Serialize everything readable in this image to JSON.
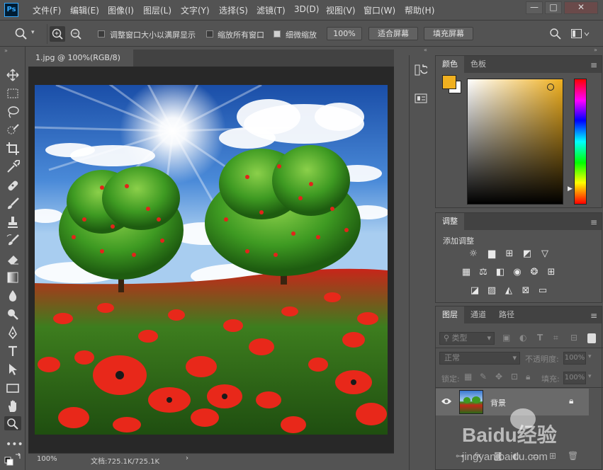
{
  "app": {
    "logo": "Ps"
  },
  "menu": [
    "文件(F)",
    "编辑(E)",
    "图像(I)",
    "图层(L)",
    "文字(Y)",
    "选择(S)",
    "滤镜(T)",
    "3D(D)",
    "视图(V)",
    "窗口(W)",
    "帮助(H)"
  ],
  "window_controls": {
    "minimize": "—",
    "maximize": "□",
    "close": "✕"
  },
  "options": {
    "resize_windows": "调整窗口大小以满屏显示",
    "zoom_all": "缩放所有窗口",
    "scrubby_zoom": "细微缩放",
    "zoom_value": "100%",
    "fit_screen": "适合屏幕",
    "fill_screen": "填充屏幕"
  },
  "document": {
    "tab_title": "1.jpg @ 100%(RGB/8)",
    "close": "×",
    "zoom": "100%",
    "doc_info": "文档:725.1K/725.1K",
    "arrow": "›"
  },
  "panels": {
    "color": {
      "tabs": [
        "颜色",
        "色板"
      ],
      "fg_color": "#f0b020",
      "bg_color": "#ffffff"
    },
    "adjustments": {
      "tab": "调整",
      "add_label": "添加调整"
    },
    "layers": {
      "tabs": [
        "图层",
        "通道",
        "路径"
      ],
      "filter_kind": "类型",
      "blend_mode": "正常",
      "opacity_label": "不透明度:",
      "opacity_value": "100%",
      "lock_label": "锁定:",
      "fill_label": "填充:",
      "fill_value": "100%",
      "layer_name": "背景"
    }
  },
  "watermark": {
    "brand": "Baidu经验",
    "url": "jingyan.baidu.com"
  },
  "icons": {
    "tools": [
      "move-icon",
      "marquee-icon",
      "lasso-icon",
      "quick-select-icon",
      "crop-icon",
      "eyedropper-icon",
      "healing-icon",
      "brush-icon",
      "stamp-icon",
      "history-brush-icon",
      "eraser-icon",
      "gradient-icon",
      "blur-icon",
      "dodge-icon",
      "pen-icon",
      "type-icon",
      "path-select-icon",
      "rectangle-icon",
      "hand-icon",
      "zoom-icon",
      "more-icon"
    ]
  },
  "colors": {
    "panel_bg": "#535353",
    "dark_bg": "#282828",
    "ps_blue": "#31a8ff"
  }
}
